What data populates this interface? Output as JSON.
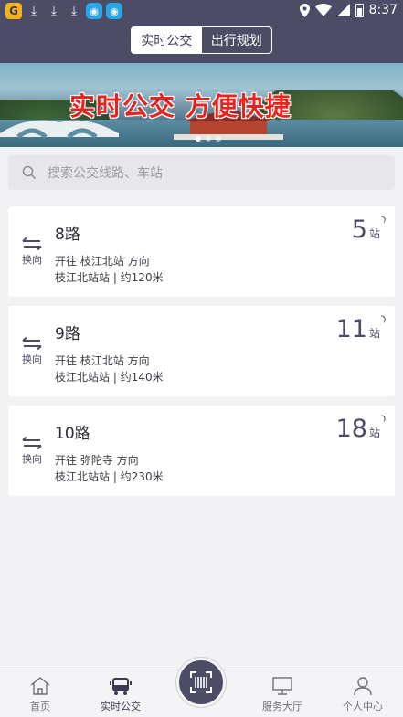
{
  "status_bar": {
    "time": "8:37",
    "icons": [
      "app-icon",
      "download-icon",
      "download-icon",
      "download-icon",
      "app-icon",
      "app-icon",
      "location-icon",
      "wifi-icon",
      "signal-icon",
      "battery-icon"
    ]
  },
  "header": {
    "tabs": [
      {
        "label": "实时公交",
        "active": true
      },
      {
        "label": "出行规划",
        "active": false
      }
    ]
  },
  "banner": {
    "slogan": "实时公交 方便快捷",
    "page_count": 3,
    "active_page": 1
  },
  "search": {
    "placeholder": "搜索公交线路、车站"
  },
  "routes": [
    {
      "name": "8路",
      "direction": "开往 枝江北站 方向",
      "info": "枝江北站站 | 约120米",
      "stops": "5",
      "stops_unit": "站",
      "swap_label": "换向"
    },
    {
      "name": "9路",
      "direction": "开往 枝江北站 方向",
      "info": "枝江北站站 | 约140米",
      "stops": "11",
      "stops_unit": "站",
      "swap_label": "换向"
    },
    {
      "name": "10路",
      "direction": "开往 弥陀寺 方向",
      "info": "枝江北站站 | 约230米",
      "stops": "18",
      "stops_unit": "站",
      "swap_label": "换向"
    }
  ],
  "bottom_nav": [
    {
      "label": "首页",
      "icon": "home-icon"
    },
    {
      "label": "实时公交",
      "icon": "bus-icon",
      "active": true
    },
    {
      "label": "",
      "icon": "scan-icon"
    },
    {
      "label": "服务大厅",
      "icon": "monitor-icon"
    },
    {
      "label": "个人中心",
      "icon": "user-icon"
    }
  ],
  "colors": {
    "primary": "#4d4c66",
    "background": "#f2f2f4",
    "banner_text": "#e8231f"
  }
}
